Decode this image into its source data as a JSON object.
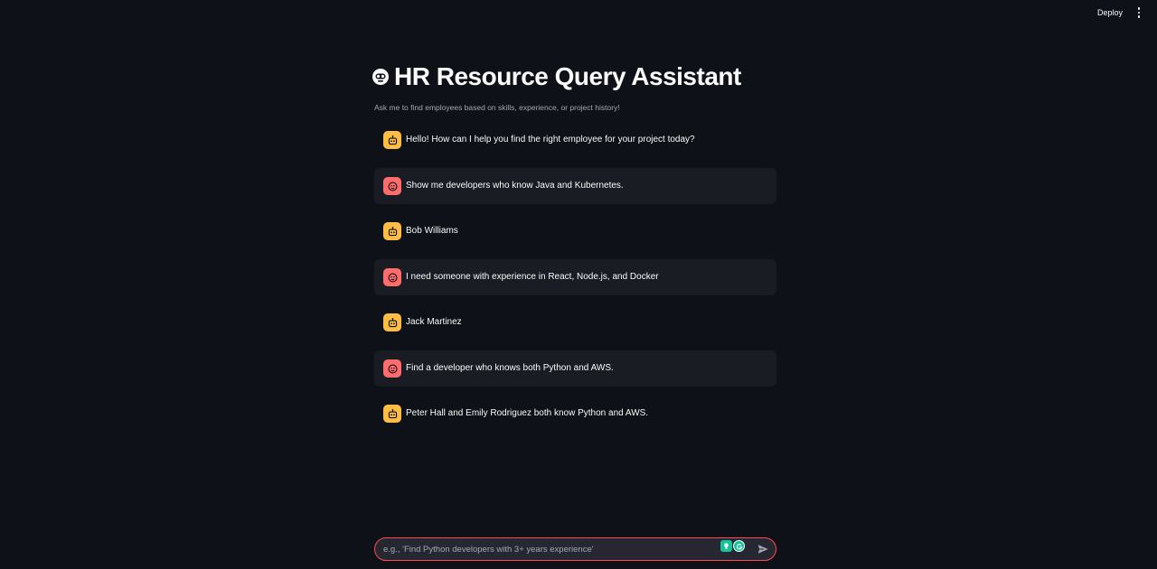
{
  "toolbar": {
    "deploy_label": "Deploy",
    "menu_icon": "kebab-vertical-icon"
  },
  "header": {
    "title": "HR Resource Query Assistant",
    "title_icon": "robot-face-icon",
    "subtitle": "Ask me to find employees based on skills, experience, or project history!"
  },
  "messages": [
    {
      "role": "assistant",
      "avatar_icon": "robot-avatar-icon",
      "text": "Hello! How can I help you find the right employee for your project today?"
    },
    {
      "role": "user",
      "avatar_icon": "user-face-avatar-icon",
      "text": "Show me developers who know Java and Kubernetes."
    },
    {
      "role": "assistant",
      "avatar_icon": "robot-avatar-icon",
      "text": "Bob Williams"
    },
    {
      "role": "user",
      "avatar_icon": "user-face-avatar-icon",
      "text": "I need someone with experience in React, Node.js, and Docker"
    },
    {
      "role": "assistant",
      "avatar_icon": "robot-avatar-icon",
      "text": "Jack Martinez"
    },
    {
      "role": "user",
      "avatar_icon": "user-face-avatar-icon",
      "text": "Find a developer who knows both Python and AWS."
    },
    {
      "role": "assistant",
      "avatar_icon": "robot-avatar-icon",
      "text": "Peter Hall and Emily Rodriguez both know Python and AWS."
    }
  ],
  "chat_input": {
    "value": "",
    "placeholder": "e.g., 'Find Python developers with 3+ years experience'",
    "send_icon": "send-arrow-icon"
  },
  "colors": {
    "background": "#0e1117",
    "assistant_avatar": "#ffbd45",
    "user_avatar": "#ff6c6c",
    "user_message_bg": "#1a1c24",
    "input_border_focus": "#ff4b4b"
  }
}
